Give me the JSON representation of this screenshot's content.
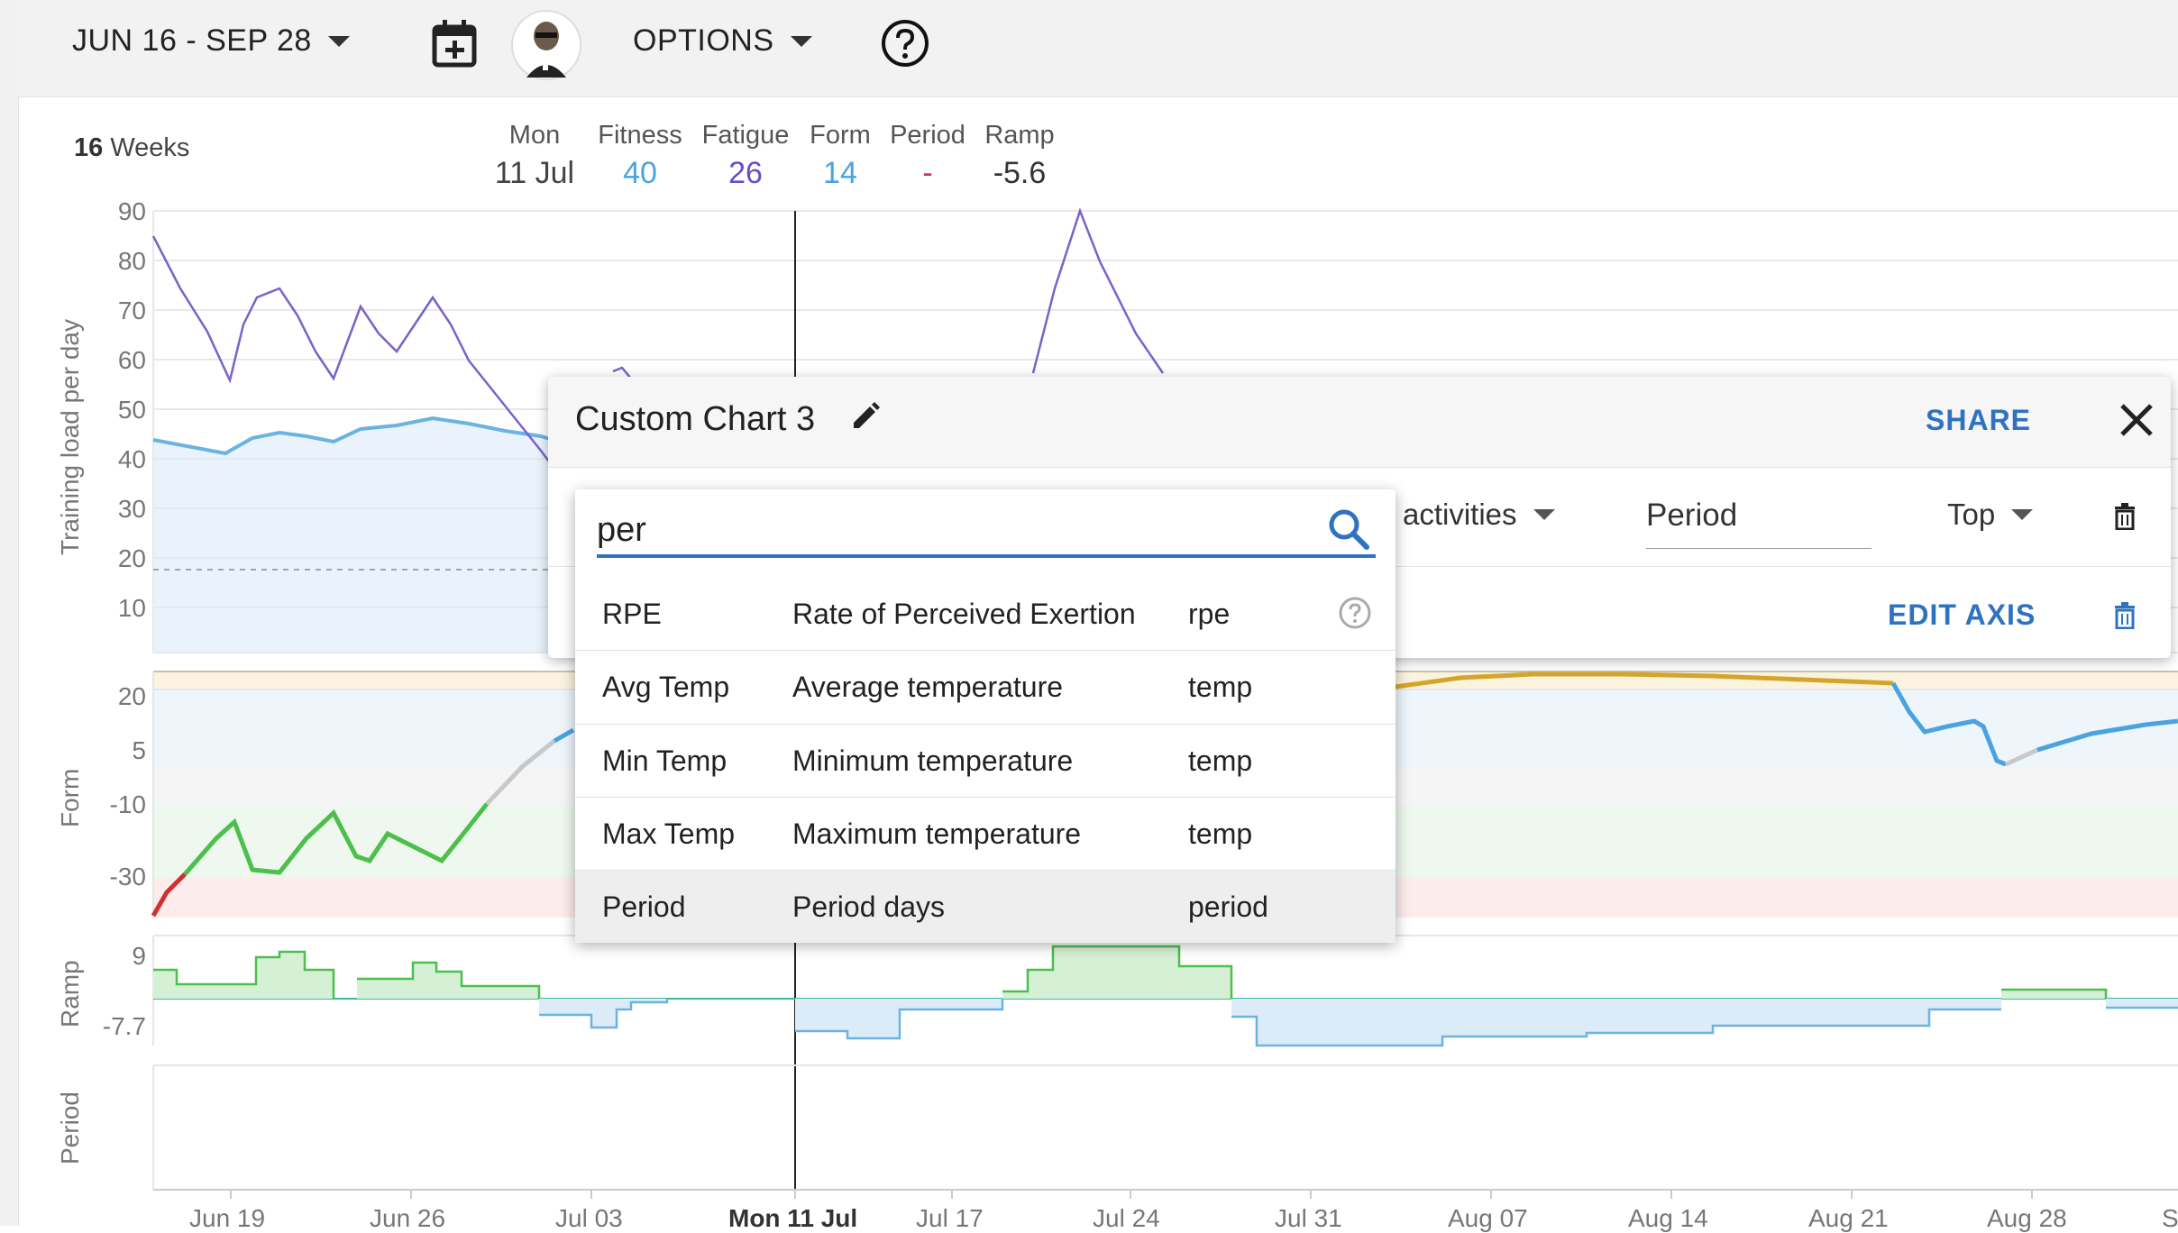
{
  "topbar": {
    "date_range": "JUN 16 - SEP 28",
    "options_label": "OPTIONS",
    "calendar_icon": "calendar-plus-icon",
    "help_icon": "help-circle-icon"
  },
  "summary": {
    "weeks_count": "16",
    "weeks_label": "Weeks",
    "stats": [
      {
        "label": "Mon",
        "value": "11 Jul",
        "color": "#444444"
      },
      {
        "label": "Fitness",
        "value": "40",
        "color": "#4aa3df"
      },
      {
        "label": "Fatigue",
        "value": "26",
        "color": "#6a4cc4"
      },
      {
        "label": "Form",
        "value": "14",
        "color": "#4aa3df"
      },
      {
        "label": "Period",
        "value": "-",
        "color": "#d0324b"
      },
      {
        "label": "Ramp",
        "value": "-5.6",
        "color": "#333333"
      }
    ]
  },
  "charts": {
    "load": {
      "ylabel": "Training load per day",
      "ticks": [
        "90",
        "80",
        "70",
        "60",
        "50",
        "40",
        "30",
        "20",
        "10"
      ]
    },
    "form": {
      "ylabel": "Form",
      "ticks": [
        "20",
        "5",
        "-10",
        "-30"
      ]
    },
    "ramp": {
      "ylabel": "Ramp",
      "ticks": [
        "9",
        "-7.7"
      ]
    },
    "period": {
      "ylabel": "Period"
    },
    "xticks": [
      "Jun 19",
      "Jun 26",
      "Jul 03",
      "Mon 11 Jul",
      "Jul 17",
      "Jul 24",
      "Jul 31",
      "Aug 07",
      "Aug 14",
      "Aug 21",
      "Aug 28",
      "S"
    ]
  },
  "custom_chart": {
    "title": "Custom Chart 3",
    "share_label": "SHARE",
    "activities_label": "activities",
    "period_value": "Period",
    "position_label": "Top",
    "edit_axis_label": "EDIT AXIS"
  },
  "search": {
    "query": "per",
    "placeholder": "",
    "results": [
      {
        "name": "RPE",
        "desc": "Rate of Perceived Exertion",
        "code": "rpe"
      },
      {
        "name": "Avg Temp",
        "desc": "Average temperature",
        "code": "temp"
      },
      {
        "name": "Min Temp",
        "desc": "Minimum temperature",
        "code": "temp"
      },
      {
        "name": "Max Temp",
        "desc": "Maximum temperature",
        "code": "temp"
      },
      {
        "name": "Period",
        "desc": "Period days",
        "code": "period"
      }
    ]
  },
  "colors": {
    "accent": "#2f73c0",
    "fitness": "#4aa3df",
    "fatigue": "#6a4cc4",
    "form_green": "#4cbf4c",
    "form_red": "#d32f2f",
    "form_gold": "#d4a52a"
  }
}
